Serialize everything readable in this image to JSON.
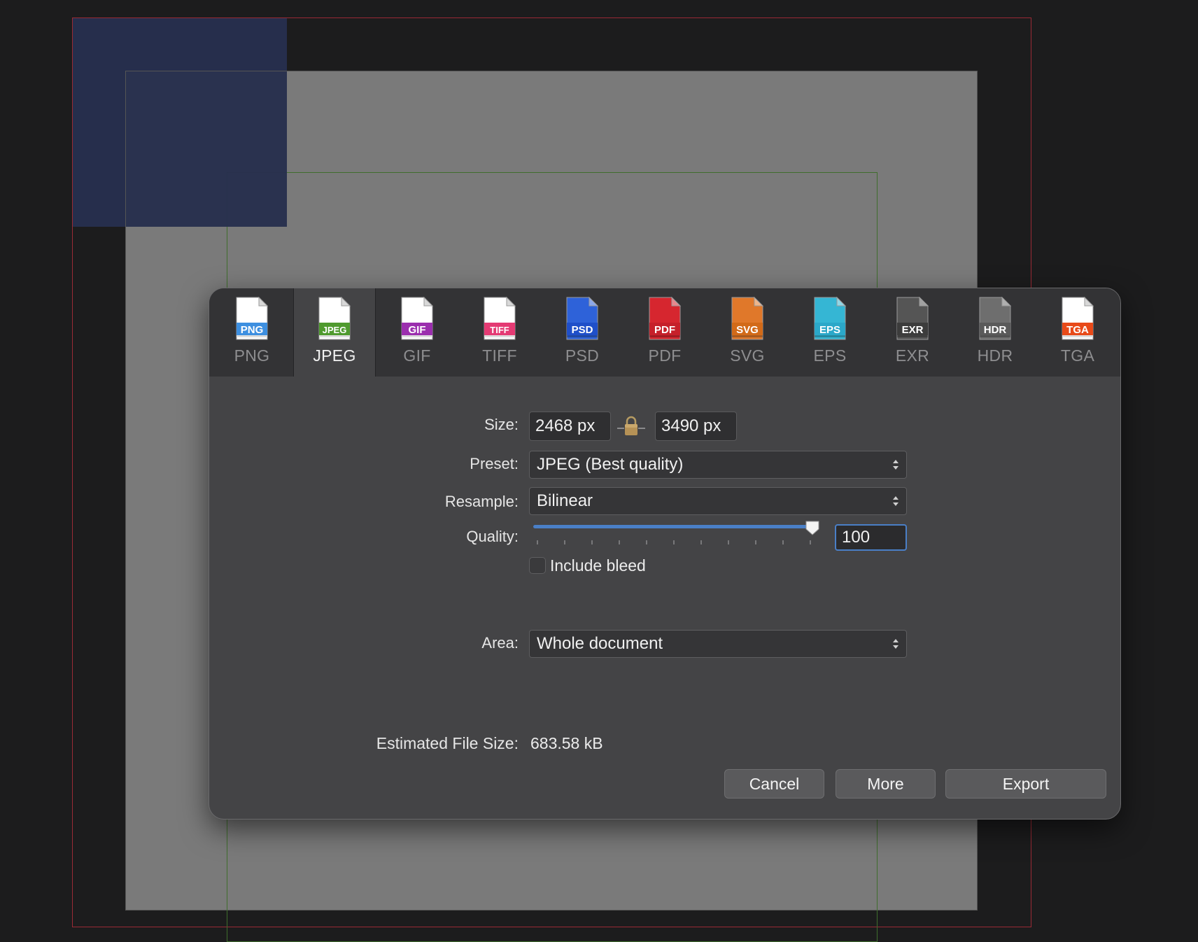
{
  "formats": [
    {
      "key": "png",
      "label": "PNG",
      "badge": "PNG",
      "color": "#3d8fe0",
      "page": "#ffffff",
      "active": false
    },
    {
      "key": "jpeg",
      "label": "JPEG",
      "badge": "JPEG",
      "color": "#4f9a2e",
      "page": "#ffffff",
      "active": true
    },
    {
      "key": "gif",
      "label": "GIF",
      "badge": "GIF",
      "color": "#9b2fae",
      "page": "#ffffff",
      "active": false
    },
    {
      "key": "tiff",
      "label": "TIFF",
      "badge": "TIFF",
      "color": "#e43a73",
      "page": "#ffffff",
      "active": false
    },
    {
      "key": "psd",
      "label": "PSD",
      "badge": "PSD",
      "color": "#1f4fc9",
      "page": "#2e62d9",
      "active": false
    },
    {
      "key": "pdf",
      "label": "PDF",
      "badge": "PDF",
      "color": "#c6202a",
      "page": "#d6262f",
      "active": false
    },
    {
      "key": "svg",
      "label": "SVG",
      "badge": "SVG",
      "color": "#d26a18",
      "page": "#e0782a",
      "active": false
    },
    {
      "key": "eps",
      "label": "EPS",
      "badge": "EPS",
      "color": "#2ba8c9",
      "page": "#35b6d4",
      "active": false
    },
    {
      "key": "exr",
      "label": "EXR",
      "badge": "EXR",
      "color": "#3c3c3c",
      "page": "#555555",
      "active": false
    },
    {
      "key": "hdr",
      "label": "HDR",
      "badge": "HDR",
      "color": "#5a5a5a",
      "page": "#6e6e6e",
      "active": false
    },
    {
      "key": "tga",
      "label": "TGA",
      "badge": "TGA",
      "color": "#e84a19",
      "page": "#ffffff",
      "active": false
    }
  ],
  "size": {
    "label": "Size:",
    "width": "2468 px",
    "height": "3490 px",
    "lock_icon": "padlock-icon"
  },
  "preset": {
    "label": "Preset:",
    "value": "JPEG (Best quality)"
  },
  "resample": {
    "label": "Resample:",
    "value": "Bilinear"
  },
  "quality": {
    "label": "Quality:",
    "value": "100",
    "slider_fraction": 1.0,
    "ticks": 11
  },
  "include_bleed": {
    "label": "Include bleed",
    "checked": false
  },
  "area": {
    "label": "Area:",
    "value": "Whole document"
  },
  "estimate": {
    "label": "Estimated File Size:",
    "value": "683.58 kB"
  },
  "buttons": {
    "cancel": "Cancel",
    "more": "More",
    "export": "Export"
  },
  "colors": {
    "accent": "#4a7fc7",
    "dialog_bg": "#444446",
    "tab_bar_bg": "#333335"
  }
}
